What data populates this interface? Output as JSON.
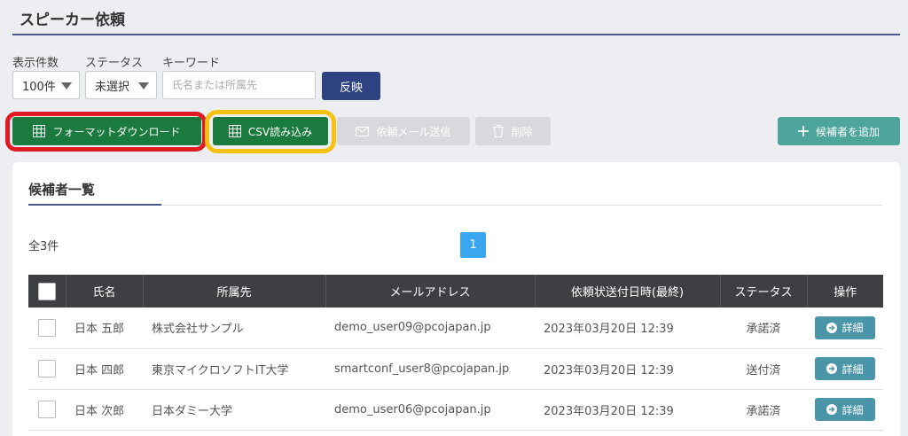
{
  "header": {
    "title": "スピーカー依頼"
  },
  "filters": {
    "count_label": "表示件数",
    "count_value": "100件",
    "status_label": "ステータス",
    "status_value": "未選択",
    "keyword_label": "キーワード",
    "keyword_placeholder": "氏名または所属先",
    "apply_label": "反映"
  },
  "actions": {
    "format_download": "フォーマットダウンロード",
    "csv_import": "CSV読み込み",
    "send_mail": "依頼メール送信",
    "delete": "削除",
    "add_candidate": "候補者を追加"
  },
  "colors": {
    "accent_navy": "#2f4382",
    "green": "#1b7a3e",
    "teal": "#4da59c",
    "highlight_red": "#e01b24",
    "highlight_yellow": "#f5c211"
  },
  "list": {
    "title": "候補者一覧",
    "total": "全3件",
    "page": "1",
    "columns": [
      "氏名",
      "所属先",
      "メールアドレス",
      "依頼状送付日時(最終)",
      "ステータス",
      "操作"
    ],
    "detail_label": "詳細",
    "rows": [
      {
        "name": "日本 五郎",
        "org": "株式会社サンプル",
        "email": "demo_user09@pcojapan.jp",
        "sent": "2023年03月20日 12:39",
        "status": "承諾済"
      },
      {
        "name": "日本 四郎",
        "org": "東京マイクロソフトIT大学",
        "email": "smartconf_user8@pcojapan.jp",
        "sent": "2023年03月20日 12:39",
        "status": "送付済"
      },
      {
        "name": "日本 次郎",
        "org": "日本ダミー大学",
        "email": "demo_user06@pcojapan.jp",
        "sent": "2023年03月20日 12:39",
        "status": "承諾済"
      }
    ]
  }
}
